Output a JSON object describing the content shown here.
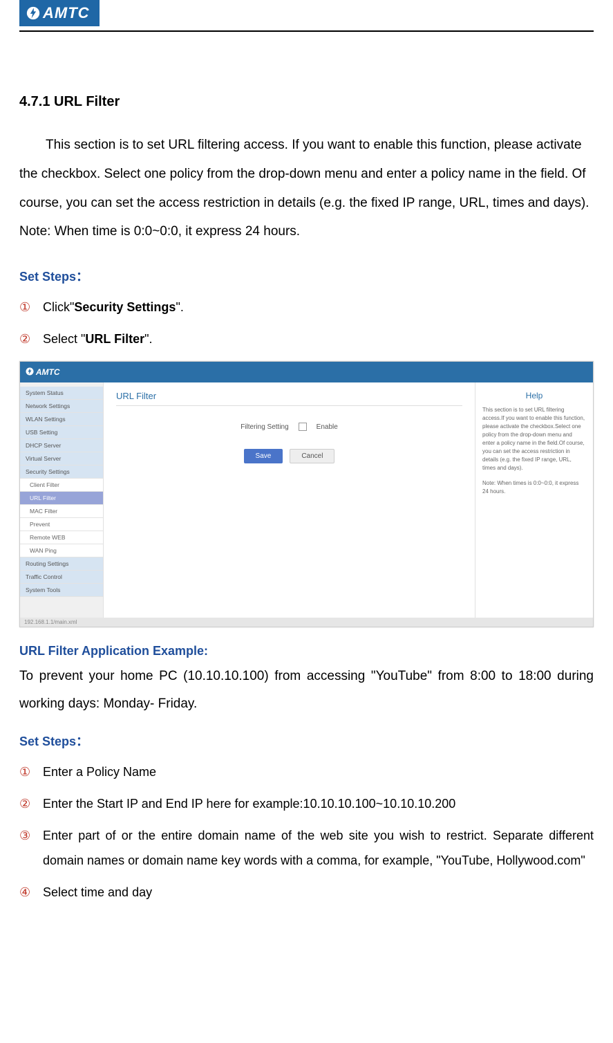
{
  "header": {
    "brand": "AMTC"
  },
  "section": {
    "title": "4.7.1 URL Filter",
    "intro": "This section is to set URL filtering access. If you want to enable this function, please activate the checkbox. Select one policy from the drop-down menu and enter a policy name in the field. Of course, you can set the access restriction in details (e.g. the fixed IP range, URL, times and days). Note: When time is 0:0~0:0, it express 24 hours."
  },
  "steps1": {
    "heading": "Set Steps：",
    "items": [
      {
        "num": "①",
        "pre": "Click\"",
        "bold": "Security Settings",
        "post": "\"."
      },
      {
        "num": "②",
        "pre": "Select \"",
        "bold": "URL Filter",
        "post": "\"."
      }
    ]
  },
  "screenshot": {
    "brand": "AMTC",
    "sidebar": [
      "System Status",
      "Network Settings",
      "WLAN Settings",
      "USB Setting",
      "DHCP Server",
      "Virtual Server",
      "Security Settings"
    ],
    "sidebar_sub": [
      "Client Filter",
      "URL Filter",
      "MAC Filter",
      "Prevent",
      "Remote WEB",
      "WAN Ping"
    ],
    "sidebar_after": [
      "Routing Settings",
      "Traffic Control",
      "System Tools"
    ],
    "main": {
      "title": "URL Filter",
      "filter_label": "Filtering Setting",
      "enable_label": "Enable",
      "save": "Save",
      "cancel": "Cancel"
    },
    "help": {
      "title": "Help",
      "p1": "This section is to set URL filtering access.If you want to enable this function, please activate the checkbox.Select one policy from the drop-down menu and enter a policy name in the field.Of course, you can set the access restriction in details (e.g. the fixed IP range, URL, times and days).",
      "p2": "Note: When times is 0:0~0:0, it express 24 hours."
    },
    "status": "192.168.1.1/main.xml"
  },
  "example": {
    "heading": "URL Filter Application Example:",
    "text": "To prevent your home PC (10.10.10.100) from accessing \"YouTube\" from 8:00 to 18:00 during working days: Monday- Friday."
  },
  "steps2": {
    "heading": "Set Steps：",
    "items": [
      {
        "num": "①",
        "text": "Enter a Policy Name"
      },
      {
        "num": "②",
        "text": "Enter the Start IP and End IP here for example:10.10.10.100~10.10.10.200"
      },
      {
        "num": "③",
        "text": "Enter part of or the entire domain name of the web site you wish to restrict. Separate different domain names or domain name key words with a comma, for example, \"YouTube, Hollywood.com\""
      },
      {
        "num": "④",
        "text": "Select time and day"
      }
    ]
  }
}
